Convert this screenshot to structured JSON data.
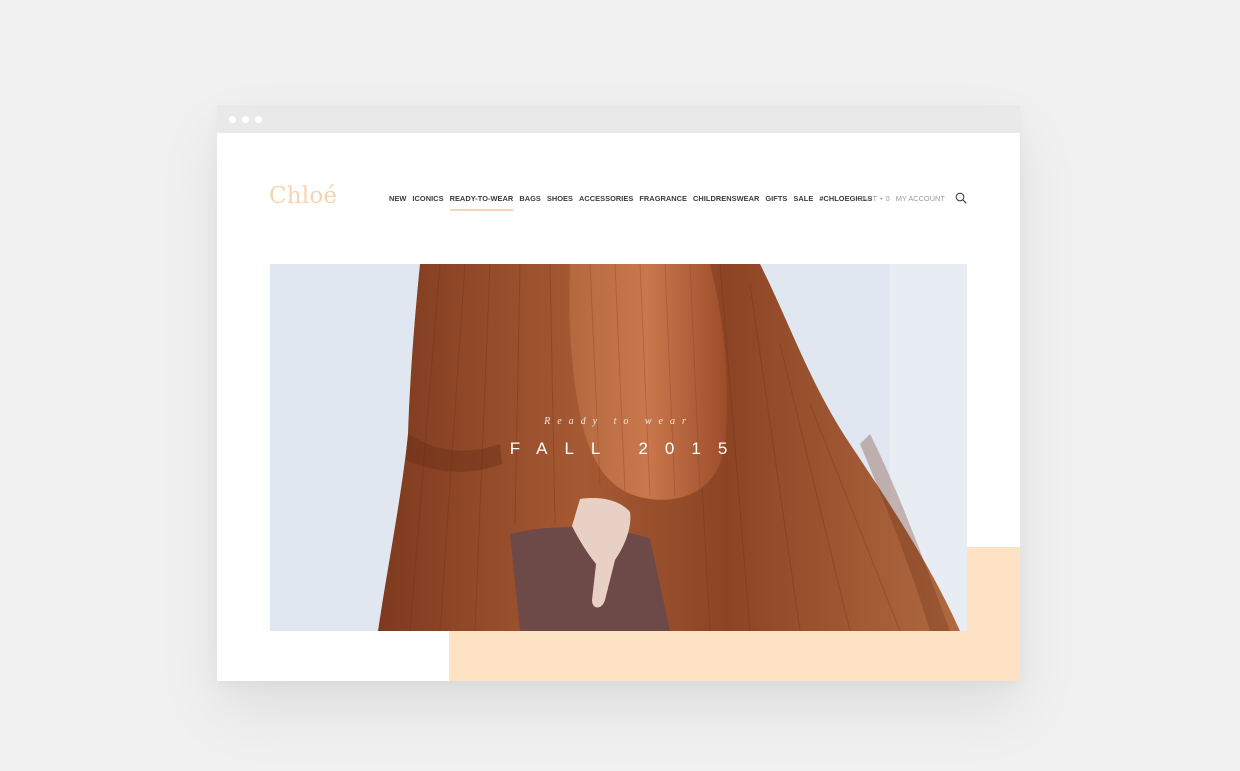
{
  "brand": {
    "logo_text": "Chloé",
    "accent": "#f6d4ad"
  },
  "nav": {
    "items": [
      {
        "label": "NEW"
      },
      {
        "label": "ICONICS"
      },
      {
        "label": "READY-TO-WEAR",
        "active": true
      },
      {
        "label": "BAGS"
      },
      {
        "label": "SHOES"
      },
      {
        "label": "ACCESSORIES"
      },
      {
        "label": "FRAGRANCE"
      },
      {
        "label": "CHILDRENSWEAR"
      },
      {
        "label": "GIFTS"
      },
      {
        "label": "SALE"
      },
      {
        "label": "#CHLOEGIRLS"
      }
    ]
  },
  "utility": {
    "cart_label": "CART",
    "cart_separator": "•",
    "cart_count": "0",
    "account_label": "MY ACCOUNT",
    "search_icon": "search-icon"
  },
  "hero": {
    "subtitle": "Ready to wear",
    "title": "FALL 2015",
    "image": "woman-in-rust-pleated-dress"
  },
  "colors": {
    "page_bg": "#f1f1f1",
    "peach": "#fde2c4",
    "dress": "#a4542f"
  }
}
